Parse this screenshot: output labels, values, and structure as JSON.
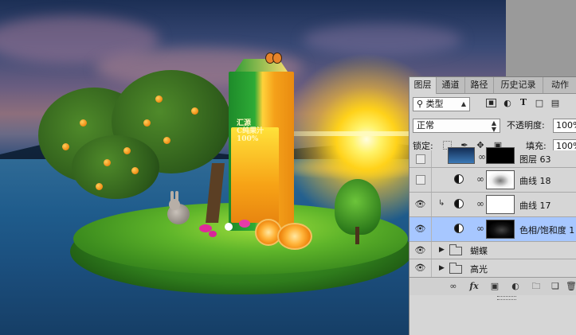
{
  "panel": {
    "tabs": [
      "图层",
      "通道",
      "路径",
      "历史记录",
      "动作"
    ],
    "active_tab": "图层",
    "filter": {
      "kind_label": "类型",
      "search_icon": "search-icon"
    },
    "filter_icons": [
      "image-filter-icon",
      "adjustment-filter-icon",
      "type-filter-icon",
      "shape-filter-icon",
      "smartobject-filter-icon"
    ],
    "blend_mode": "正常",
    "opacity_label": "不透明度:",
    "opacity_value": "100%",
    "lock_label": "锁定:",
    "fill_label": "填充:",
    "fill_value": "100%",
    "layers": [
      {
        "name": "图层 63",
        "visible": false,
        "kind": "image-mask"
      },
      {
        "name": "曲线 18",
        "visible": false,
        "kind": "adjustment"
      },
      {
        "name": "曲线 17",
        "visible": true,
        "kind": "adjustment",
        "clipped": true
      },
      {
        "name": "色相/饱和度 1",
        "visible": true,
        "kind": "adjustment",
        "selected": true
      },
      {
        "name": "蝴蝶",
        "visible": true,
        "kind": "group"
      },
      {
        "name": "高光",
        "visible": true,
        "kind": "group"
      }
    ],
    "footer_icons": [
      "link-icon",
      "fx-icon",
      "mask-icon",
      "adjustment-icon",
      "folder-icon",
      "new-layer-icon",
      "trash-icon"
    ],
    "fx_label": "fx"
  },
  "artwork": {
    "carton_text": [
      "汇源",
      "C纯果汁",
      "100%"
    ]
  }
}
